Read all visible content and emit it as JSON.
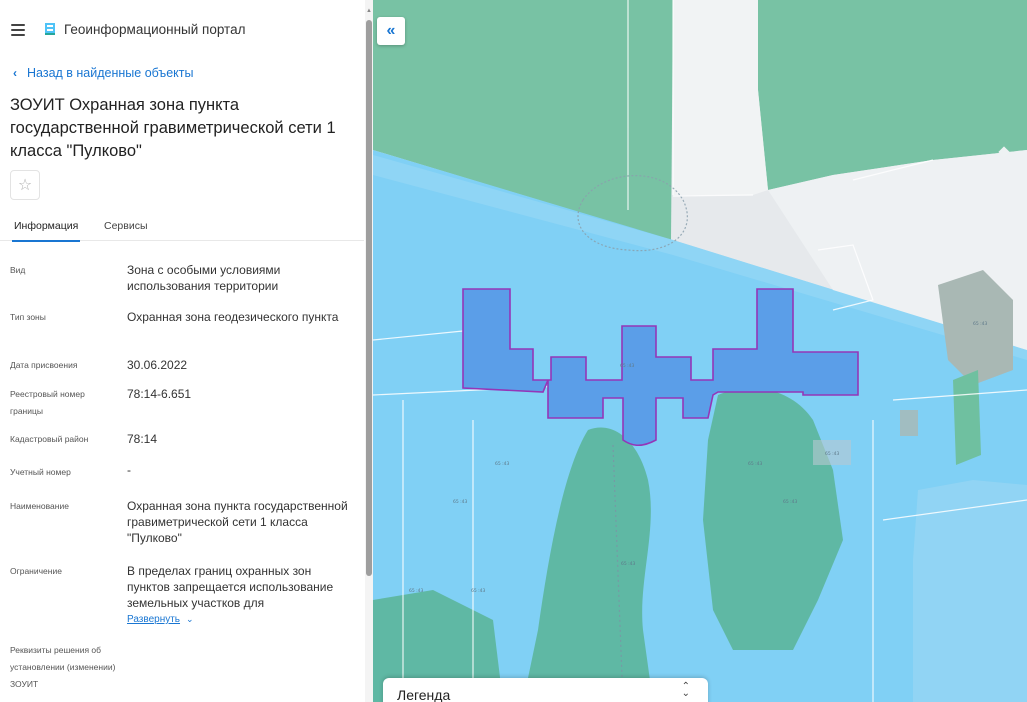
{
  "header": {
    "menu_icon": "hamburger-icon",
    "logo_icon": "portal-logo-icon",
    "title": "Геоинформационный портал"
  },
  "nav": {
    "back_label": "Назад в найденные объекты"
  },
  "object": {
    "title": "ЗОУИТ Охранная зона пункта государственной гравиметрической сети 1 класса \"Пулково\"",
    "favorite_icon": "star-icon"
  },
  "tabs": [
    {
      "label": "Информация",
      "active": true
    },
    {
      "label": "Сервисы",
      "active": false
    }
  ],
  "attributes": [
    {
      "label": "Вид",
      "value": "Зона с особыми условиями использования территории"
    },
    {
      "label": "Тип зоны",
      "value": "Охранная зона геодезического пункта"
    },
    {
      "label": "Дата присвоения",
      "value": "30.06.2022"
    },
    {
      "label": "Реестровый номер границы",
      "value": "78:14-6.651"
    },
    {
      "label": "Кадастровый район",
      "value": "78:14"
    },
    {
      "label": "Учетный номер",
      "value": "-"
    },
    {
      "label": "Наименование",
      "value": "Охранная зона пункта государственной гравиметрической сети 1 класса \"Пулково\""
    },
    {
      "label": "Ограничение",
      "value": "В пределах границ охранных зон пунктов запрещается использование земельных участков для"
    },
    {
      "label": "Реквизиты решения об установлении (изменении) ЗОУИТ",
      "value": ""
    }
  ],
  "expand_label": "Развернуть",
  "map": {
    "collapse_icon": "double-chevron-left-icon",
    "legend_label": "Легенда",
    "legend_toggle_icon": "up-down-chevron-icon",
    "colors": {
      "zone_fill": "#81d4fa",
      "green": "#66bb9a",
      "building": "#5c9be6",
      "building_outline": "#8e24aa"
    }
  }
}
